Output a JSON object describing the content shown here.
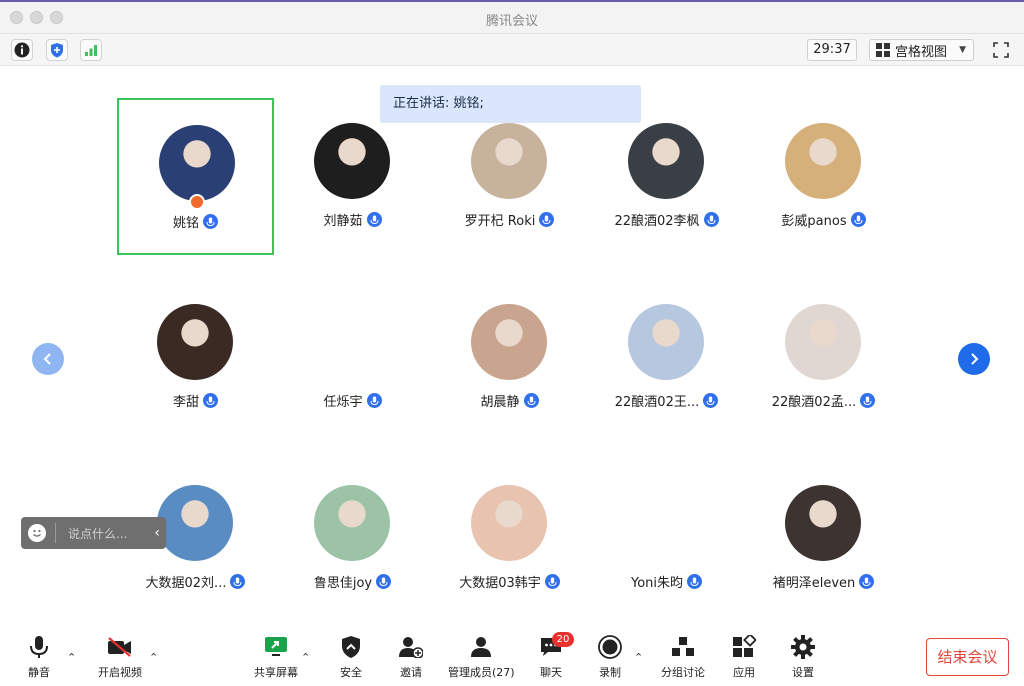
{
  "window": {
    "title": "腾讯会议"
  },
  "toolbar": {
    "icons": [
      "info-icon",
      "shield-icon",
      "signal-icon"
    ],
    "timer": "29:37",
    "view_mode": "宫格视图",
    "fullscreen_icon": "fullscreen-icon"
  },
  "speaking": {
    "text": "正在讲话: 姚铭;"
  },
  "participants": [
    {
      "name": "姚铭",
      "host": true,
      "active": true,
      "avatar_color": "#2a3f73"
    },
    {
      "name": "刘静茹",
      "avatar_color": "#1e1e1e"
    },
    {
      "name": "罗开杞 Roki",
      "avatar_color": "#c7b39b"
    },
    {
      "name": "22酿酒02李枫",
      "avatar_color": "#3a3f45"
    },
    {
      "name": "彭威panos",
      "avatar_color": "#d6b07a"
    },
    {
      "name": "李甜",
      "avatar_color": "#3b2a24"
    },
    {
      "name": "任烁宇",
      "avatar_color": "#ffffff"
    },
    {
      "name": "胡晨静",
      "avatar_color": "#c9a48e"
    },
    {
      "name": "22酿酒02王...",
      "avatar_color": "#b6c7e0"
    },
    {
      "name": "22酿酒02孟...",
      "avatar_color": "#e0d6d2"
    },
    {
      "name": "大数据02刘...",
      "avatar_color": "#5a8cc4"
    },
    {
      "name": "鲁思佳joy",
      "avatar_color": "#9cc3a6"
    },
    {
      "name": "大数据03韩宇",
      "avatar_color": "#e8c4b0"
    },
    {
      "name": "Yoni朱昀",
      "avatar_color": "#ffffff"
    },
    {
      "name": "褚明泽eleven",
      "avatar_color": "#3d3330"
    }
  ],
  "chat": {
    "placeholder": "说点什么...",
    "emoji_icon": "smile-icon"
  },
  "bottombar": {
    "mute": "静音",
    "video": "开启视频",
    "share": "共享屏幕",
    "security": "安全",
    "invite": "邀请",
    "members": "管理成员(27)",
    "chat": "聊天",
    "chat_badge": "20",
    "record": "录制",
    "breakout": "分组讨论",
    "apps": "应用",
    "settings": "设置",
    "end": "结束会议"
  },
  "colors": {
    "accent": "#3170ea",
    "active_border": "#3ec35a",
    "end": "#e0463d"
  }
}
